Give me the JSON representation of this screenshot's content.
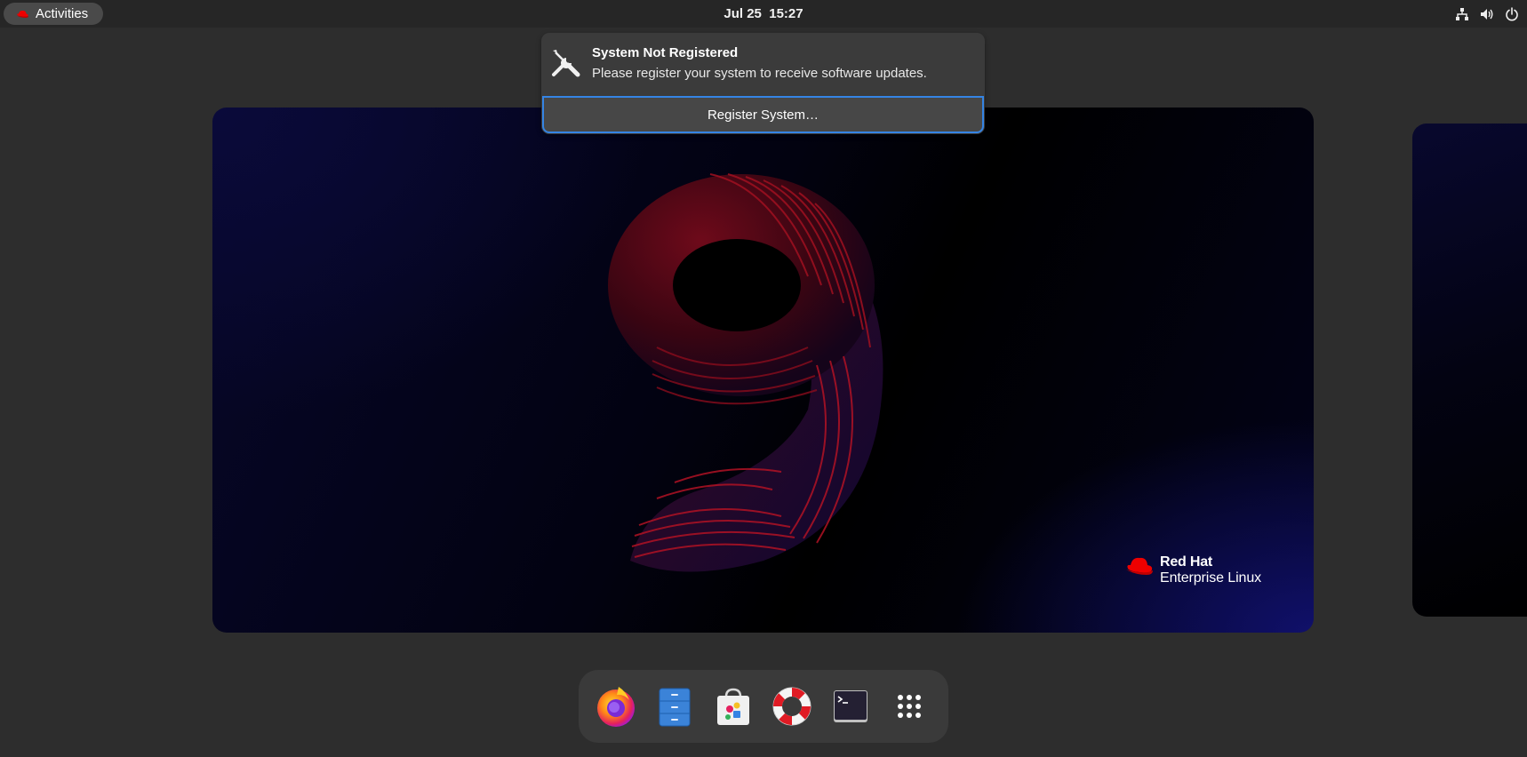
{
  "topbar": {
    "activities_label": "Activities",
    "clock": "Jul 25  15:27",
    "tray_icons": [
      "network-icon",
      "volume-icon",
      "power-icon"
    ]
  },
  "notification": {
    "icon": "tools-icon",
    "title": "System Not Registered",
    "body": "Please register your system to receive software updates.",
    "action_label": "Register System…"
  },
  "wallpaper": {
    "brand_line1": "Red Hat",
    "brand_line2": "Enterprise Linux",
    "colors": {
      "accent_red": "#c8102e",
      "background": "#02020f"
    }
  },
  "dash": {
    "apps": [
      {
        "name": "Firefox",
        "icon": "firefox-icon"
      },
      {
        "name": "Files",
        "icon": "files-icon"
      },
      {
        "name": "Software",
        "icon": "software-icon"
      },
      {
        "name": "Help",
        "icon": "help-icon"
      },
      {
        "name": "Terminal",
        "icon": "terminal-icon"
      },
      {
        "name": "Show Applications",
        "icon": "app-grid-icon"
      }
    ]
  },
  "colors": {
    "focus_ring": "#3584e4",
    "panel": "#262626",
    "overview_bg": "#2d2d2d"
  }
}
